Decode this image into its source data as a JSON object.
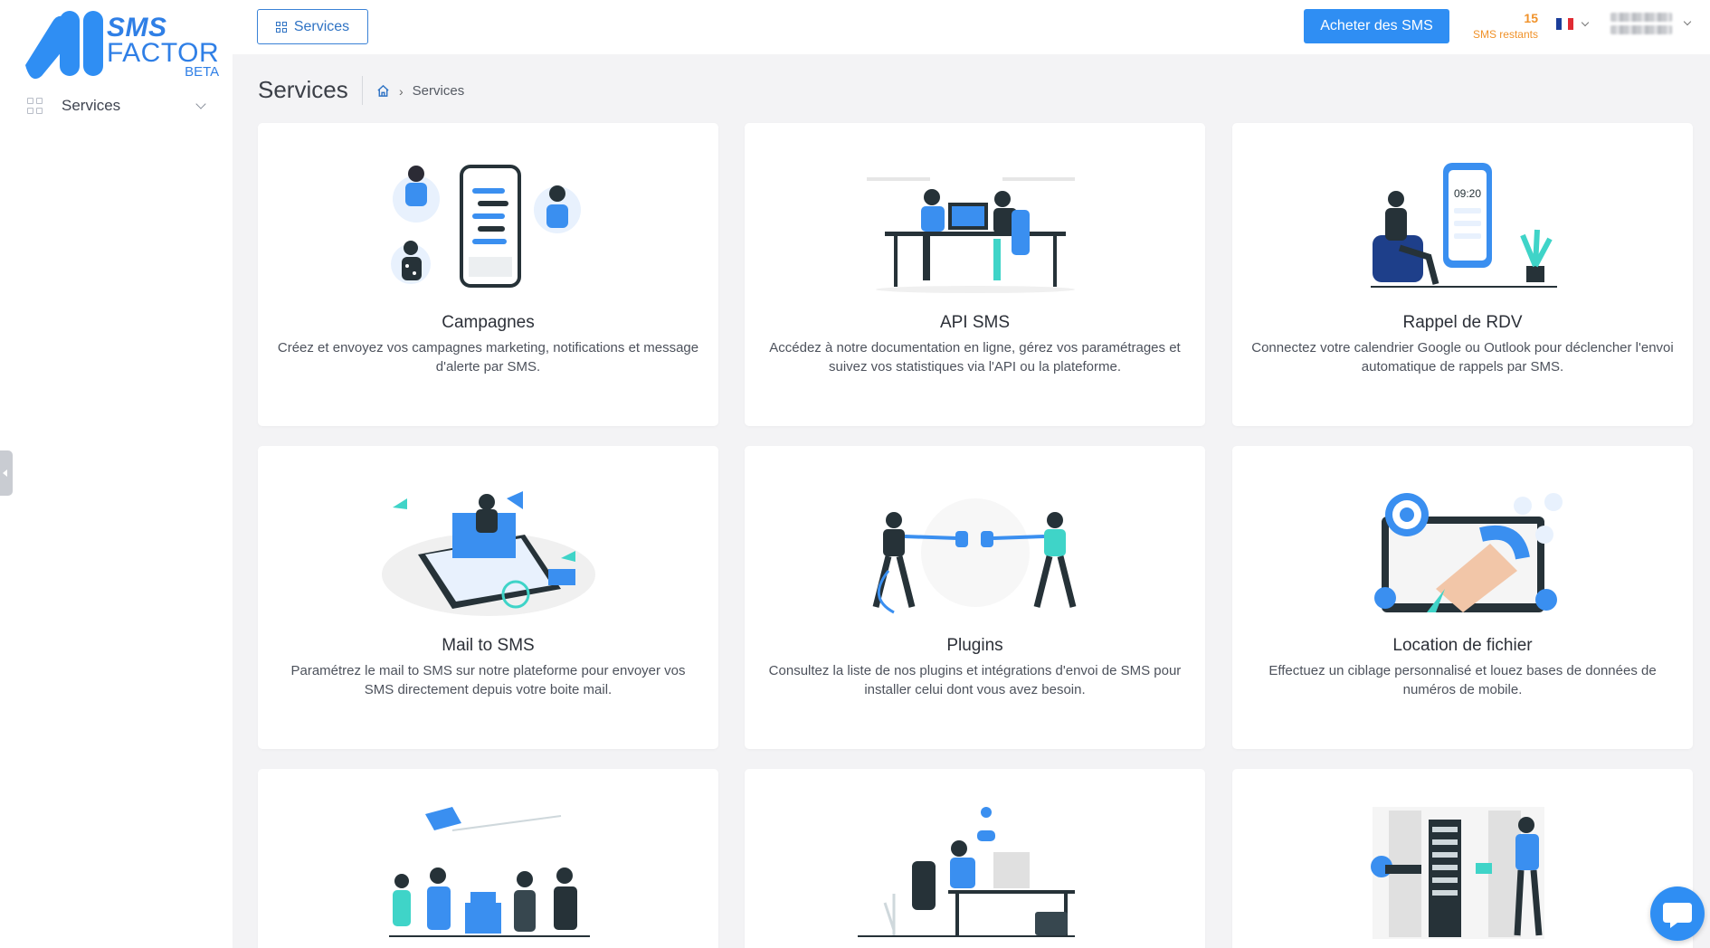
{
  "brand": {
    "line1": "SMS",
    "line2": "FACTOR",
    "line3": "BETA",
    "accent": "#2f8ef3"
  },
  "sidebar": {
    "items": [
      {
        "label": "Services",
        "icon": "grid-icon"
      }
    ]
  },
  "topbar": {
    "services_button": "Services",
    "buy_button": "Acheter des SMS",
    "sms_count": "15",
    "sms_label": "SMS restants",
    "language": "fr"
  },
  "page": {
    "title": "Services",
    "breadcrumb": [
      "Services"
    ]
  },
  "cards": [
    {
      "title": "Campagnes",
      "desc": "Créez et envoyez vos campagnes marketing, notifications et message d'alerte par SMS."
    },
    {
      "title": "API SMS",
      "desc": "Accédez à notre documentation en ligne, gérez vos paramétrages et suivez vos statistiques via l'API ou la plateforme."
    },
    {
      "title": "Rappel de RDV",
      "desc": "Connectez votre calendrier Google ou Outlook pour déclencher l'envoi automatique de rappels par SMS."
    },
    {
      "title": "Mail to SMS",
      "desc": "Paramétrez le mail to SMS sur notre plateforme pour envoyer vos SMS directement depuis votre boite mail."
    },
    {
      "title": "Plugins",
      "desc": "Consultez la liste de nos plugins et intégrations d'envoi de SMS pour installer celui dont vous avez besoin."
    },
    {
      "title": "Location de fichier",
      "desc": "Effectuez un ciblage personnalisé et louez bases de données de numéros de mobile."
    },
    {
      "title": "",
      "desc": ""
    },
    {
      "title": "",
      "desc": ""
    },
    {
      "title": "",
      "desc": ""
    }
  ],
  "phone_time": "09:20"
}
